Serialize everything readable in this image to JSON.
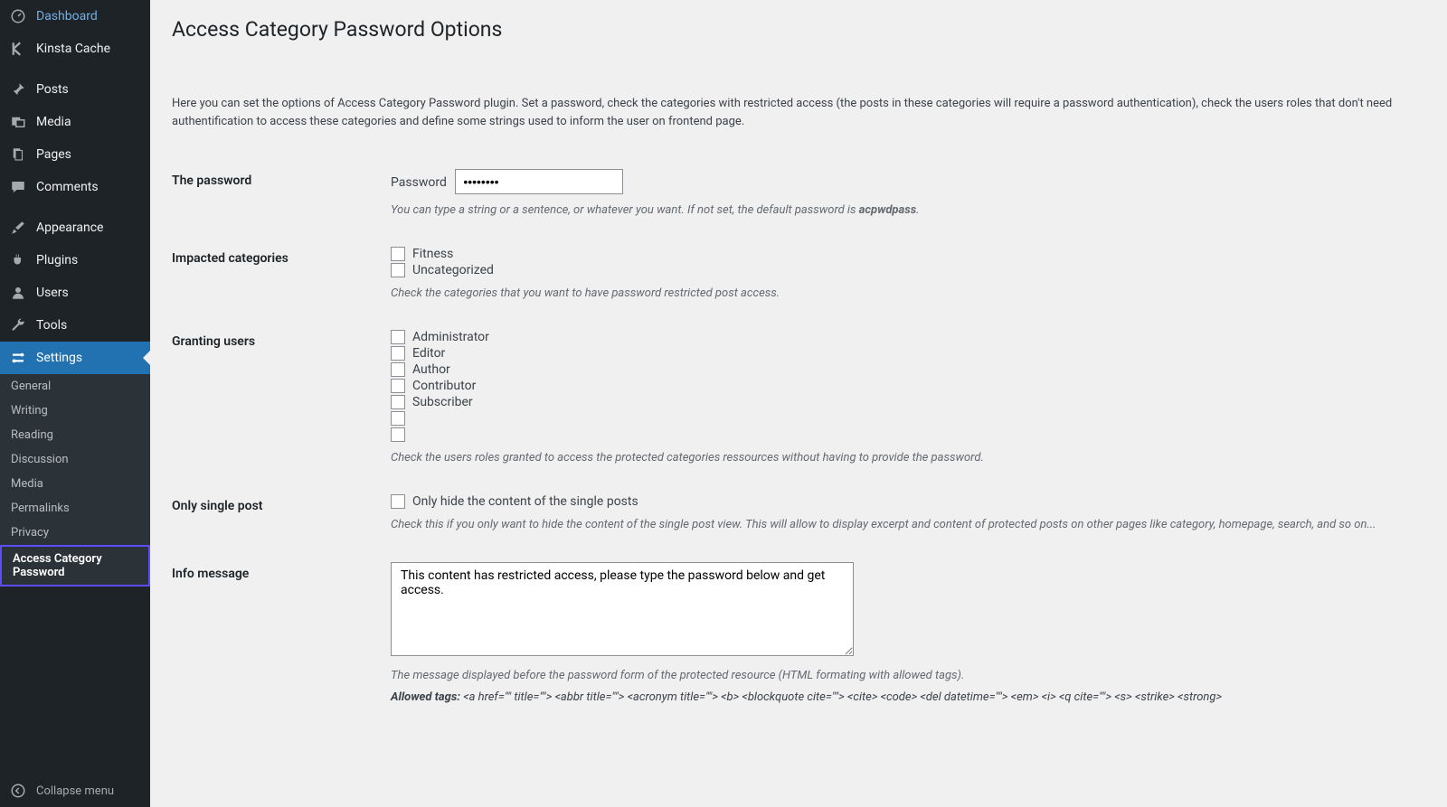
{
  "sidebar": {
    "items": [
      {
        "label": "Dashboard"
      },
      {
        "label": "Kinsta Cache"
      },
      {
        "label": "Posts"
      },
      {
        "label": "Media"
      },
      {
        "label": "Pages"
      },
      {
        "label": "Comments"
      },
      {
        "label": "Appearance"
      },
      {
        "label": "Plugins"
      },
      {
        "label": "Users"
      },
      {
        "label": "Tools"
      },
      {
        "label": "Settings"
      }
    ],
    "submenu": [
      "General",
      "Writing",
      "Reading",
      "Discussion",
      "Media",
      "Permalinks",
      "Privacy",
      "Access Category Password"
    ],
    "collapse": "Collapse menu"
  },
  "page": {
    "title": "Access Category Password Options",
    "intro": "Here you can set the options of Access Category Password plugin. Set a password, check the categories with restricted access (the posts in these categories will require a password authentication), check the users roles that don't need authentification to access these categories and define some strings used to inform the user on frontend page."
  },
  "form": {
    "password": {
      "heading": "The password",
      "label": "Password",
      "value": "••••••••",
      "hint_pre": "You can type a string or a sentence, or whatever you want. If not set, the default password is ",
      "hint_strong": "acpwdpass",
      "hint_post": "."
    },
    "categories": {
      "heading": "Impacted categories",
      "items": [
        "Fitness",
        "Uncategorized"
      ],
      "hint": "Check the categories that you want to have password restricted post access."
    },
    "users": {
      "heading": "Granting users",
      "items": [
        "Administrator",
        "Editor",
        "Author",
        "Contributor",
        "Subscriber",
        "",
        ""
      ],
      "hint": "Check the users roles granted to access the protected categories ressources without having to provide the password."
    },
    "single": {
      "heading": "Only single post",
      "label": "Only hide the content of the single posts",
      "hint": "Check this if you only want to hide the content of the single post view. This will allow to display excerpt and content of protected posts on other pages like category, homepage, search, and so on..."
    },
    "info": {
      "heading": "Info message",
      "value": "This content has restricted access, please type the password below and get access.",
      "hint": "The message displayed before the password form of the protected resource (HTML formating with allowed tags).",
      "allowed_label": "Allowed tags:",
      "allowed_tags": "<a href=\"\" title=\"\"> <abbr title=\"\"> <acronym title=\"\"> <b> <blockquote cite=\"\"> <cite> <code> <del datetime=\"\"> <em> <i> <q cite=\"\"> <s> <strike> <strong>"
    }
  }
}
